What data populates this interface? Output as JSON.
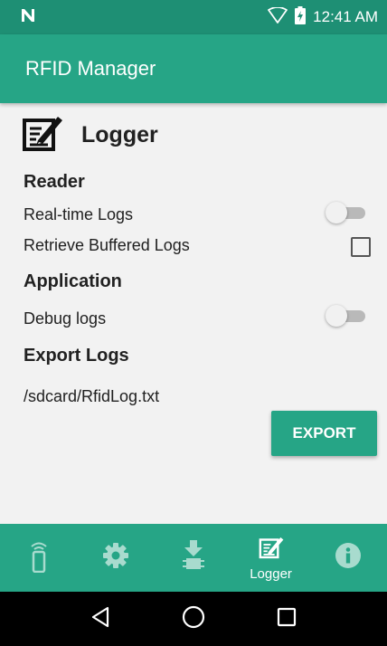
{
  "status_bar": {
    "time": "12:41 AM"
  },
  "app_bar": {
    "title": "RFID Manager"
  },
  "page": {
    "title": "Logger"
  },
  "reader": {
    "section_title": "Reader",
    "realtime_label": "Real-time Logs",
    "realtime_enabled": false,
    "buffered_label": "Retrieve Buffered Logs",
    "buffered_checked": false
  },
  "application": {
    "section_title": "Application",
    "debug_label": "Debug logs",
    "debug_enabled": false
  },
  "export": {
    "section_title": "Export Logs",
    "path": "/sdcard/RfidLog.txt",
    "button_label": "EXPORT"
  },
  "bottom_nav": {
    "items": [
      {
        "icon": "rfid-reader-icon",
        "label": ""
      },
      {
        "icon": "gear-icon",
        "label": ""
      },
      {
        "icon": "firmware-download-icon",
        "label": ""
      },
      {
        "icon": "logger-icon",
        "label": "Logger"
      },
      {
        "icon": "info-icon",
        "label": ""
      }
    ],
    "active_index": 3
  },
  "colors": {
    "status_bar": "#1e8f74",
    "primary": "#26a586",
    "background": "#f2f2f2",
    "text": "#212121"
  }
}
